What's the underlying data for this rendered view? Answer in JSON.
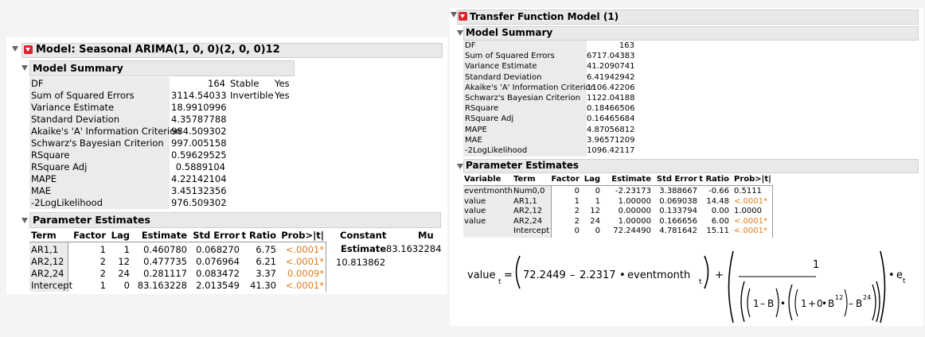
{
  "left": {
    "title": "Model: Seasonal ARIMA(1, 0, 0)(2, 0, 0)12",
    "model_summary": {
      "title": "Model Summary",
      "rows": [
        {
          "label": "DF",
          "value": "164"
        },
        {
          "label": "Sum of Squared Errors",
          "value": "3114.54033"
        },
        {
          "label": "Variance Estimate",
          "value": "18.9910996"
        },
        {
          "label": "Standard Deviation",
          "value": "4.35787788"
        },
        {
          "label": "Akaike's 'A' Information Criterion",
          "value": "984.509302"
        },
        {
          "label": "Schwarz's Bayesian Criterion",
          "value": "997.005158"
        },
        {
          "label": "RSquare",
          "value": "0.59629525"
        },
        {
          "label": "RSquare Adj",
          "value": "0.5889104"
        },
        {
          "label": "MAPE",
          "value": "4.22142104"
        },
        {
          "label": "MAE",
          "value": "3.45132356"
        },
        {
          "label": "-2LogLikelihood",
          "value": "976.509302"
        }
      ],
      "side": [
        {
          "label": "Stable",
          "value": "Yes"
        },
        {
          "label": "Invertible",
          "value": "Yes"
        }
      ]
    },
    "parameter_estimates": {
      "title": "Parameter Estimates",
      "headers": [
        "Term",
        "Factor",
        "Lag",
        "Estimate",
        "Std Error",
        "t Ratio",
        "Prob>|t|"
      ],
      "rows": [
        [
          "AR1,1",
          "1",
          "1",
          "0.460780",
          "0.068270",
          "6.75",
          "<.0001*"
        ],
        [
          "AR2,12",
          "2",
          "12",
          "0.477735",
          "0.076964",
          "6.21",
          "<.0001*"
        ],
        [
          "AR2,24",
          "2",
          "24",
          "0.281117",
          "0.083472",
          "3.37",
          "0.0009*"
        ],
        [
          "Intercept",
          "1",
          "0",
          "83.163228",
          "2.013549",
          "41.30",
          "<.0001*"
        ]
      ],
      "constant": {
        "header": "Constant",
        "sub": "Estimate",
        "value": "10.813862"
      },
      "mu": {
        "header": "Mu",
        "value": "83.1632284"
      }
    }
  },
  "right": {
    "title": "Transfer Function Model (1)",
    "model_summary": {
      "title": "Model Summary",
      "rows": [
        {
          "label": "DF",
          "value": "163"
        },
        {
          "label": "Sum of Squared Errors",
          "value": "6717.04383"
        },
        {
          "label": "Variance Estimate",
          "value": "41.2090741"
        },
        {
          "label": "Standard Deviation",
          "value": "6.41942942"
        },
        {
          "label": "Akaike's 'A' Information Criterion",
          "value": "1106.42206"
        },
        {
          "label": "Schwarz's Bayesian Criterion",
          "value": "1122.04188"
        },
        {
          "label": "RSquare",
          "value": "0.18466506"
        },
        {
          "label": "RSquare Adj",
          "value": "0.16465684"
        },
        {
          "label": "MAPE",
          "value": "4.87056812"
        },
        {
          "label": "MAE",
          "value": "3.96571209"
        },
        {
          "label": "-2LogLikelihood",
          "value": "1096.42117"
        }
      ]
    },
    "parameter_estimates": {
      "title": "Parameter Estimates",
      "headers": [
        "Variable",
        "Term",
        "Factor",
        "Lag",
        "Estimate",
        "Std Error",
        "t Ratio",
        "Prob>|t|"
      ],
      "rows": [
        [
          "eventmonth",
          "Num0,0",
          "0",
          "0",
          "-2.23173",
          "3.388667",
          "-0.66",
          "0.5111"
        ],
        [
          "value",
          "AR1,1",
          "1",
          "1",
          "1.00000",
          "0.069038",
          "14.48",
          "<.0001*"
        ],
        [
          "value",
          "AR2,12",
          "2",
          "12",
          "0.00000",
          "0.133794",
          "0.00",
          "1.0000"
        ],
        [
          "value",
          "AR2,24",
          "2",
          "24",
          "1.00000",
          "0.166656",
          "6.00",
          "<.0001*"
        ],
        [
          "",
          "Intercept",
          "0",
          "0",
          "72.24490",
          "4.781642",
          "15.11",
          "<.0001*"
        ]
      ]
    },
    "formula": {
      "lhs": "value",
      "sub_t": "t",
      "equals": "=",
      "intercept_term": "72.2449",
      "minus": "–",
      "coef": "2.2317",
      "dot": "•",
      "var": "eventmonth",
      "plus": "+",
      "numerator": "1",
      "one": "1",
      "zero": "0",
      "b": "B",
      "exp12": "12",
      "exp24": "24",
      "e": "e"
    },
    "colors": {
      "orange": "#e07b1a",
      "header_bg": "#e9e9e9",
      "label_bg": "#ebebeb"
    }
  }
}
